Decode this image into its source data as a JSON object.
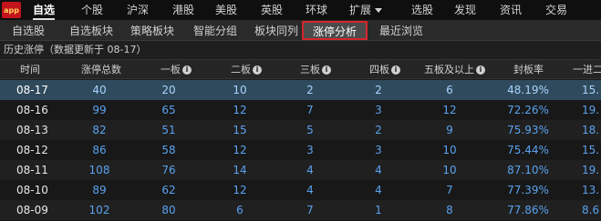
{
  "logo_text": "app",
  "topnav": [
    {
      "label": "自选",
      "active": true
    },
    {
      "label": "个股"
    },
    {
      "label": "沪深"
    },
    {
      "label": "港股"
    },
    {
      "label": "美股"
    },
    {
      "label": "英股"
    },
    {
      "label": "环球"
    },
    {
      "label": "扩展"
    },
    {
      "label": "选股"
    },
    {
      "label": "发现"
    },
    {
      "label": "资讯"
    },
    {
      "label": "交易"
    }
  ],
  "subnav": [
    "自选股",
    "自选板块",
    "策略板块",
    "智能分组",
    "板块同列",
    "涨停分析",
    "最近浏览"
  ],
  "info_text": "历史涨停（数据更新于 08-17）",
  "columns": [
    "时间",
    "涨停总数",
    "一板",
    "二板",
    "三板",
    "四板",
    "五板及以上",
    "封板率",
    "一进二"
  ],
  "rows": [
    {
      "date": "08-17",
      "total": "40",
      "b1": "20",
      "b2": "10",
      "b3": "2",
      "b4": "2",
      "b5": "6",
      "rate": "48.19%",
      "next": "15."
    },
    {
      "date": "08-16",
      "total": "99",
      "b1": "65",
      "b2": "12",
      "b3": "7",
      "b4": "3",
      "b5": "12",
      "rate": "72.26%",
      "next": "19."
    },
    {
      "date": "08-13",
      "total": "82",
      "b1": "51",
      "b2": "15",
      "b3": "5",
      "b4": "2",
      "b5": "9",
      "rate": "75.93%",
      "next": "18."
    },
    {
      "date": "08-12",
      "total": "86",
      "b1": "58",
      "b2": "12",
      "b3": "3",
      "b4": "3",
      "b5": "10",
      "rate": "75.44%",
      "next": "15."
    },
    {
      "date": "08-11",
      "total": "108",
      "b1": "76",
      "b2": "14",
      "b3": "4",
      "b4": "4",
      "b5": "10",
      "rate": "87.10%",
      "next": "19."
    },
    {
      "date": "08-10",
      "total": "89",
      "b1": "62",
      "b2": "12",
      "b3": "4",
      "b4": "4",
      "b5": "7",
      "rate": "77.39%",
      "next": "13."
    },
    {
      "date": "08-09",
      "total": "102",
      "b1": "80",
      "b2": "6",
      "b3": "7",
      "b4": "1",
      "b5": "8",
      "rate": "77.86%",
      "next": "8.6"
    }
  ],
  "colors": {
    "number": "#5aa2ee",
    "highlight_row": "#2f4a5c",
    "selected_tab_border": "#d3262b"
  }
}
